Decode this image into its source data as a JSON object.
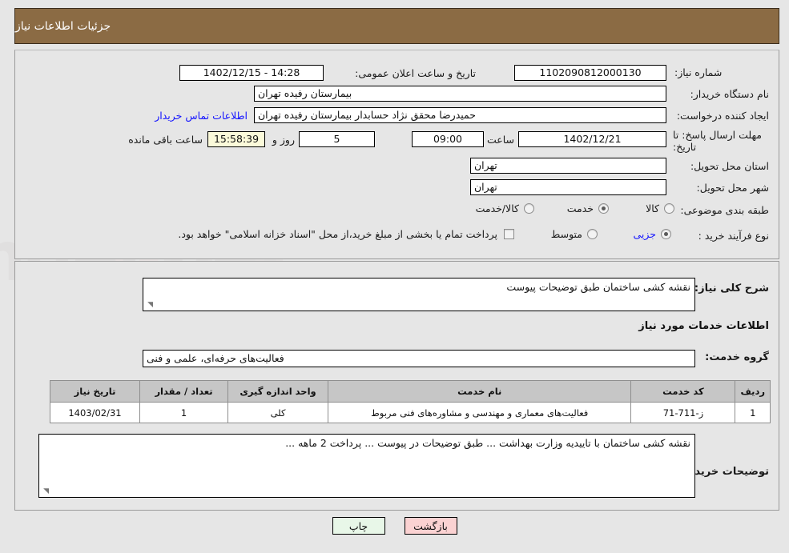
{
  "header": {
    "title": "جزئیات اطلاعات نیاز"
  },
  "form": {
    "need_number": {
      "label": "شماره نیاز:",
      "value": "1102090812000130"
    },
    "announce_datetime": {
      "label": "تاریخ و ساعت اعلان عمومی:",
      "value": "14:28 - 1402/12/15"
    },
    "buyer_org": {
      "label": "نام دستگاه خریدار:",
      "value": "بیمارستان رفیده تهران"
    },
    "requester": {
      "label": "ایجاد کننده درخواست:",
      "value": "حمیدرضا  محقق نژاد حسابدار بیمارستان رفیده تهران"
    },
    "contact_link": "اطلاعات تماس خریدار",
    "deadline": {
      "label": "مهلت ارسال پاسخ: تا تاریخ:",
      "date": "1402/12/21",
      "hour_label": "ساعت",
      "hour": "09:00",
      "days": "5",
      "days_suffix": "روز و",
      "timer": "15:58:39",
      "timer_suffix": "ساعت باقی مانده"
    },
    "province": {
      "label": "استان محل تحویل:",
      "value": "تهران"
    },
    "city": {
      "label": "شهر محل تحویل:",
      "value": "تهران"
    },
    "category": {
      "label": "طبقه بندی موضوعی:",
      "options": [
        "کالا",
        "خدمت",
        "کالا/خدمت"
      ],
      "selected": "خدمت"
    },
    "purchase_process": {
      "label": "نوع فرآیند خرید :",
      "options": [
        "جزیی",
        "متوسط"
      ],
      "selected": "جزیی",
      "checkbox_text": "پرداخت تمام یا بخشی از مبلغ خرید،از محل \"اسناد خزانه اسلامی\" خواهد بود.",
      "checkbox_checked": false
    }
  },
  "description": {
    "label": "شرح کلی نیاز:",
    "value": "نقشه کشی ساختمان طبق توضیحات پیوست"
  },
  "services_section": {
    "heading": "اطلاعات خدمات مورد نیاز",
    "group_label": "گروه خدمت:",
    "group_value": "فعالیت‌های حرفه‌ای، علمی و فنی",
    "table": {
      "columns": [
        "ردیف",
        "کد خدمت",
        "نام خدمت",
        "واحد اندازه گیری",
        "تعداد / مقدار",
        "تاریخ نیاز"
      ],
      "rows": [
        [
          "1",
          "ز-711-71",
          "فعالیت‌های معماری و مهندسی و مشاوره‌های فنی مربوط",
          "کلی",
          "1",
          "1403/02/31"
        ]
      ]
    }
  },
  "buyer_notes": {
    "label": "توضیحات خریدار:",
    "value": "نقشه کشی ساختمان با تاییدیه وزارت بهداشت ... طبق توضیحات در پیوست ... پرداخت 2 ماهه ..."
  },
  "footer": {
    "print_label": "چاپ",
    "back_label": "بازگشت"
  },
  "watermark": {
    "text": "AriaTender.net"
  },
  "colors": {
    "header_bg": "#8b6b44",
    "page_bg": "#e6e6e6",
    "link": "#1414ff",
    "timer_bg": "#fbfada",
    "print_bg": "#e8f7e8",
    "back_bg": "#fbd2d2",
    "table_header_bg": "#c6c6c6"
  }
}
